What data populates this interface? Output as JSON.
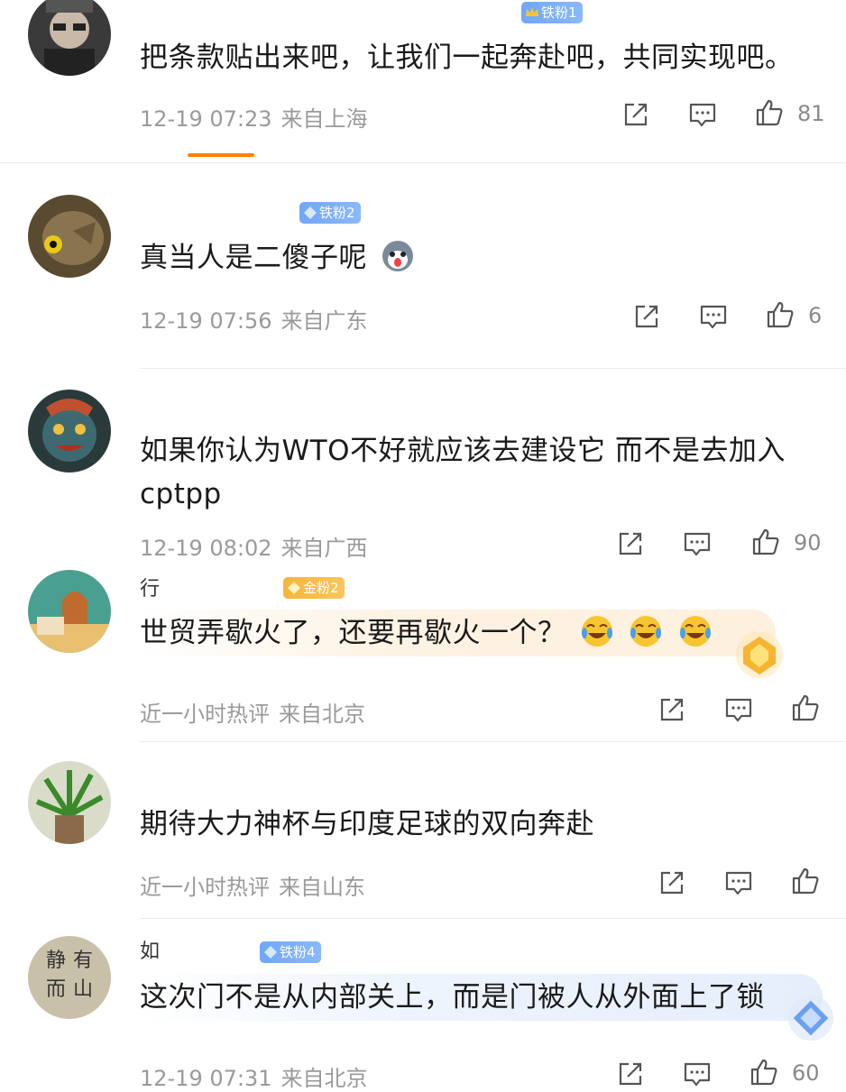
{
  "comments": [
    {
      "badge": "铁粉1",
      "text": "把条款贴出来吧，让我们一起奔赴吧，共同实现吧。",
      "time": "12-19 07:23",
      "location": "来自上海",
      "likes": "81"
    },
    {
      "badge": "铁粉2",
      "text": "真当人是二傻子呢",
      "time": "12-19 07:56",
      "location": "来自广东",
      "likes": "6"
    },
    {
      "text": "如果你认为WTO不好就应该去建设它 而不是去加入cptpp",
      "time": "12-19 08:02",
      "location": "来自广西",
      "likes": "90"
    },
    {
      "username": "行",
      "badge": "金粉2",
      "text": "世贸弄歇火了，还要再歇火一个？",
      "time": "近一小时热评",
      "location": "来自北京",
      "likes": ""
    },
    {
      "text": "期待大力神杯与印度足球的双向奔赴",
      "time": "近一小时热评",
      "location": "来自山东",
      "likes": ""
    },
    {
      "username": "如",
      "badge": "铁粉4",
      "text": "这次门不是从内部关上，而是门被人从外面上了锁",
      "time": "12-19 07:31",
      "location": "来自北京",
      "likes": "60"
    }
  ],
  "icons": {
    "share": "share-icon",
    "comment": "comment-icon",
    "like": "thumbs-up-icon"
  },
  "colors": {
    "accent": "#ff8200",
    "badge_blue": "#6fa8f7",
    "badge_gold": "#f6b53b",
    "meta": "#9a9a9a"
  }
}
